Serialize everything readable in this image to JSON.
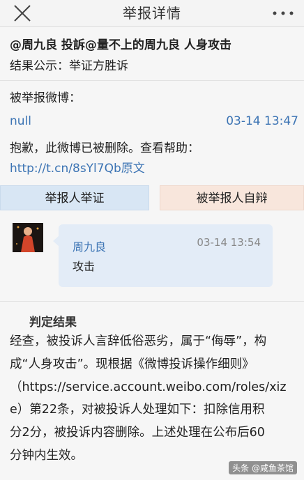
{
  "header": {
    "title": "举报详情",
    "close_icon": "close-icon",
    "more_icon": "more-icon"
  },
  "report": {
    "title": "@周九良 投訴@量不上的周九良 人身攻击",
    "result_line": "结果公示：举证方胜诉"
  },
  "reported_weibo": {
    "label": "被举报微博：",
    "user": "null",
    "time": "03-14 13:47",
    "message": "抱歉，此微博已被删除。查看帮助：",
    "help_link": "http://t.cn/8sYl7Qb原文"
  },
  "tabs": {
    "reporter": "举报人举证",
    "reported": "被举报人自辩"
  },
  "evidence": {
    "user": "周九良",
    "time": "03-14 13:54",
    "text": "攻击"
  },
  "verdict": {
    "heading": "判定结果",
    "lines": [
      "经查，被投诉人言辞低俗恶劣，属于“侮辱”，构",
      "成“人身攻击”。现根据《微博投诉操作细则》",
      "（https://service.account.weibo.com/roles/xiz",
      "e）第22条，对被投诉人处理如下：扣除信用积",
      "分2分，被投诉内容删除。上述处理在公布后60",
      "分钟内生效。"
    ]
  },
  "watermark": "头条 @咸鱼茶馆",
  "colors": {
    "link": "#3c74b4",
    "tab_reporter_bg": "#d8e6f4",
    "tab_reported_bg": "#f8e6dc",
    "bubble_bg": "#e3ecf7"
  }
}
